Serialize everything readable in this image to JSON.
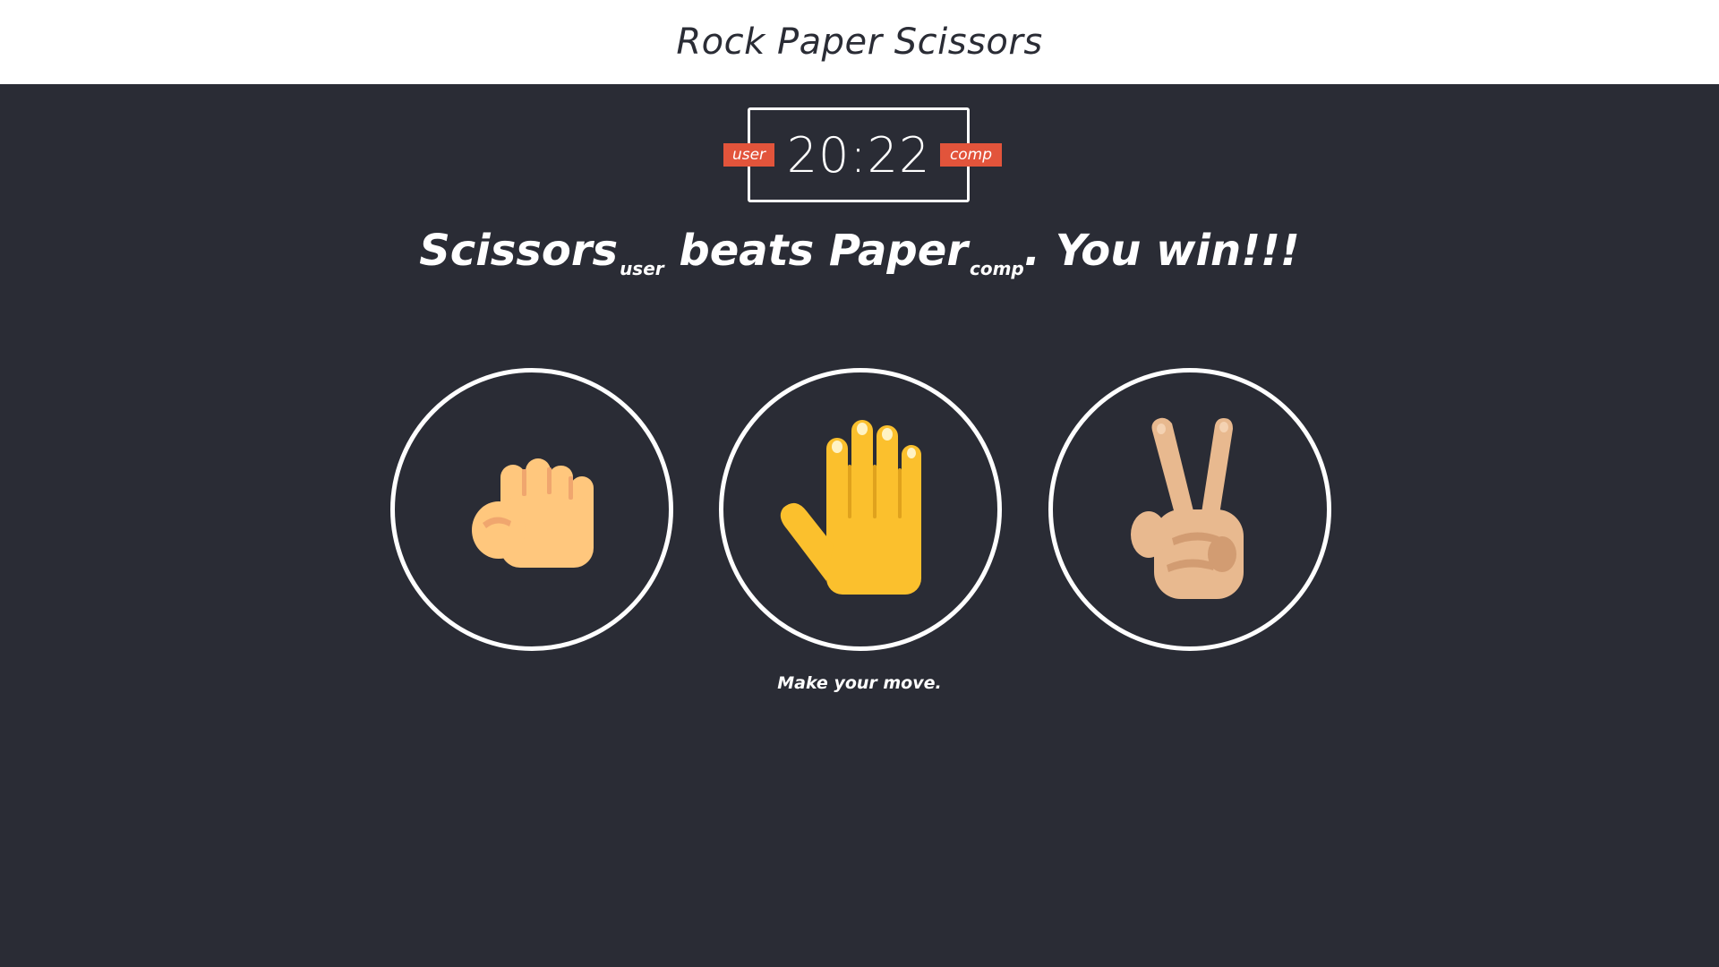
{
  "header": {
    "title": "Rock Paper Scissors"
  },
  "scoreboard": {
    "score": "20:22",
    "user_label": "user",
    "comp_label": "comp"
  },
  "result": {
    "user_choice": "Scissors",
    "user_tag": "user",
    "verb": "beats",
    "comp_choice": "Paper",
    "comp_tag": "comp",
    "suffix": ". You win!!!"
  },
  "choices": [
    {
      "name": "rock",
      "icon": "raised-fist-icon"
    },
    {
      "name": "paper",
      "icon": "raised-hand-icon"
    },
    {
      "name": "scissors",
      "icon": "victory-hand-icon"
    }
  ],
  "prompt": "Make your move.",
  "colors": {
    "background": "#2a2c35",
    "header_background": "#ffffff",
    "badge": "#e2543b",
    "ring": "#ffffff",
    "rock_skin": "#ffc77d",
    "paper_skin": "#fbc02d",
    "scissors_skin": "#e8b98f"
  }
}
